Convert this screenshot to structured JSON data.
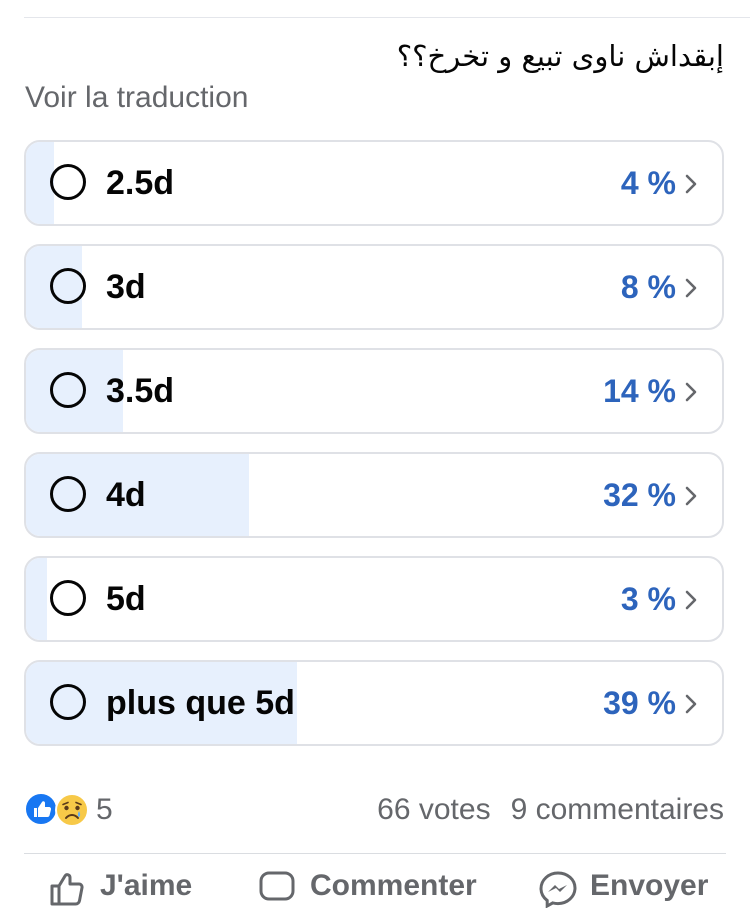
{
  "post": {
    "question": "إبقداش ناوى تبيع و تخرخ؟؟",
    "translate_link": "Voir la traduction"
  },
  "poll": {
    "options": [
      {
        "label": "2.5d",
        "percent_text": "4 %",
        "percent": 4
      },
      {
        "label": "3d",
        "percent_text": "8 %",
        "percent": 8
      },
      {
        "label": "3.5d",
        "percent_text": "14 %",
        "percent": 14
      },
      {
        "label": "4d",
        "percent_text": "32 %",
        "percent": 32
      },
      {
        "label": "5d",
        "percent_text": "3 %",
        "percent": 3
      },
      {
        "label": "plus que 5d",
        "percent_text": "39 %",
        "percent": 39
      }
    ]
  },
  "footer": {
    "reaction_count": "5",
    "votes": "66 votes",
    "comments": "9 commentaires",
    "actions": {
      "like": "J'aime",
      "comment": "Commenter",
      "send": "Envoyer"
    }
  },
  "colors": {
    "accent": "#2d64bc",
    "bar_fill": "#e7f0fd",
    "border": "#dfe1e6",
    "muted_text": "#65676b"
  },
  "icons": {
    "reactions": [
      "like-icon",
      "sad-icon"
    ],
    "option": [
      "radio-circle-icon",
      "chevron-right-icon"
    ],
    "actions": [
      "thumbs-up-icon",
      "comment-icon",
      "messenger-icon"
    ]
  }
}
